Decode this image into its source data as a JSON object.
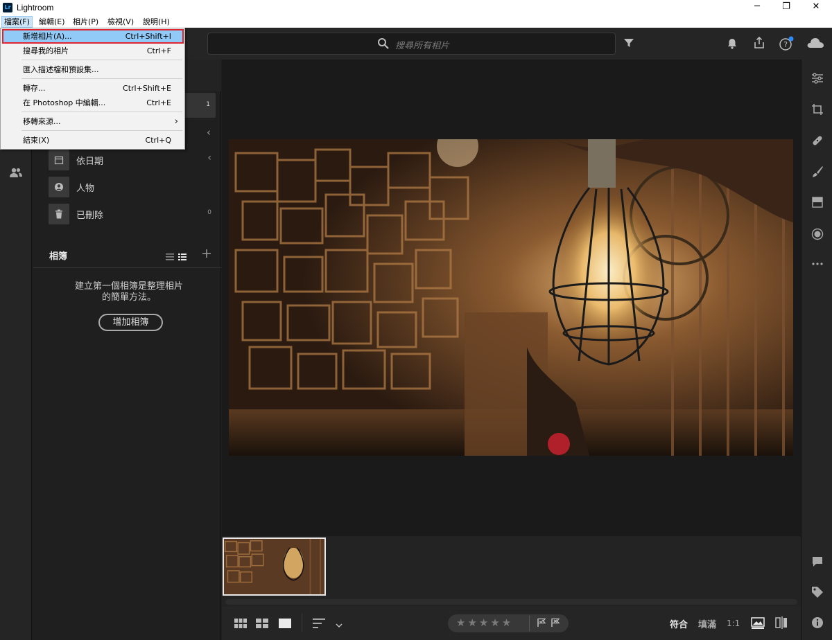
{
  "window": {
    "title": "Lightroom",
    "logo_text": "Lr",
    "controls": [
      "─",
      "❐",
      "✕"
    ]
  },
  "menubar": {
    "items": [
      "檔案(F)",
      "編輯(E)",
      "相片(P)",
      "檢視(V)",
      "說明(H)"
    ],
    "active": "檔案(F)"
  },
  "file_menu": {
    "items": [
      {
        "label": "新增相片(A)...",
        "shortcut": "Ctrl+Shift+I",
        "highlighted": true
      },
      {
        "label": "搜尋我的相片",
        "shortcut": "Ctrl+F"
      },
      {
        "label": "匯入描述檔和預設集..."
      },
      {
        "label": "轉存...",
        "shortcut": "Ctrl+Shift+E"
      },
      {
        "label": "在 Photoshop 中編輯...",
        "shortcut": "Ctrl+E"
      },
      {
        "label": "移轉來源...",
        "submenu": "›"
      },
      {
        "label": "結束(X)",
        "shortcut": "Ctrl+Q"
      }
    ]
  },
  "search": {
    "placeholder": "搜尋所有相片"
  },
  "left_panel": {
    "rows": [
      {
        "label": "",
        "count": "1",
        "icon": "photos-icon"
      },
      {
        "label": "",
        "chevron": "‹",
        "icon": "recent-icon"
      },
      {
        "label": "依日期",
        "chevron": "‹",
        "icon": "calendar-icon"
      },
      {
        "label": "人物",
        "icon": "people-icon"
      },
      {
        "label": "已刪除",
        "count": "0",
        "icon": "trash-icon"
      }
    ],
    "albums_title": "相簿",
    "albums_empty_line1": "建立第一個相簿是整理相片",
    "albums_empty_line2": "的簡單方法。",
    "add_album_label": "增加相簿"
  },
  "bottom_bar": {
    "stars": "★★★★★",
    "fit_label": "符合",
    "fill_label": "填滿",
    "ratio_label": "1:1"
  },
  "colors": {
    "highlight_border": "#e0242f",
    "menu_highlight": "#91c9f7",
    "app_bg": "#1e1e1e",
    "notification_dot": "#2f8cff"
  }
}
